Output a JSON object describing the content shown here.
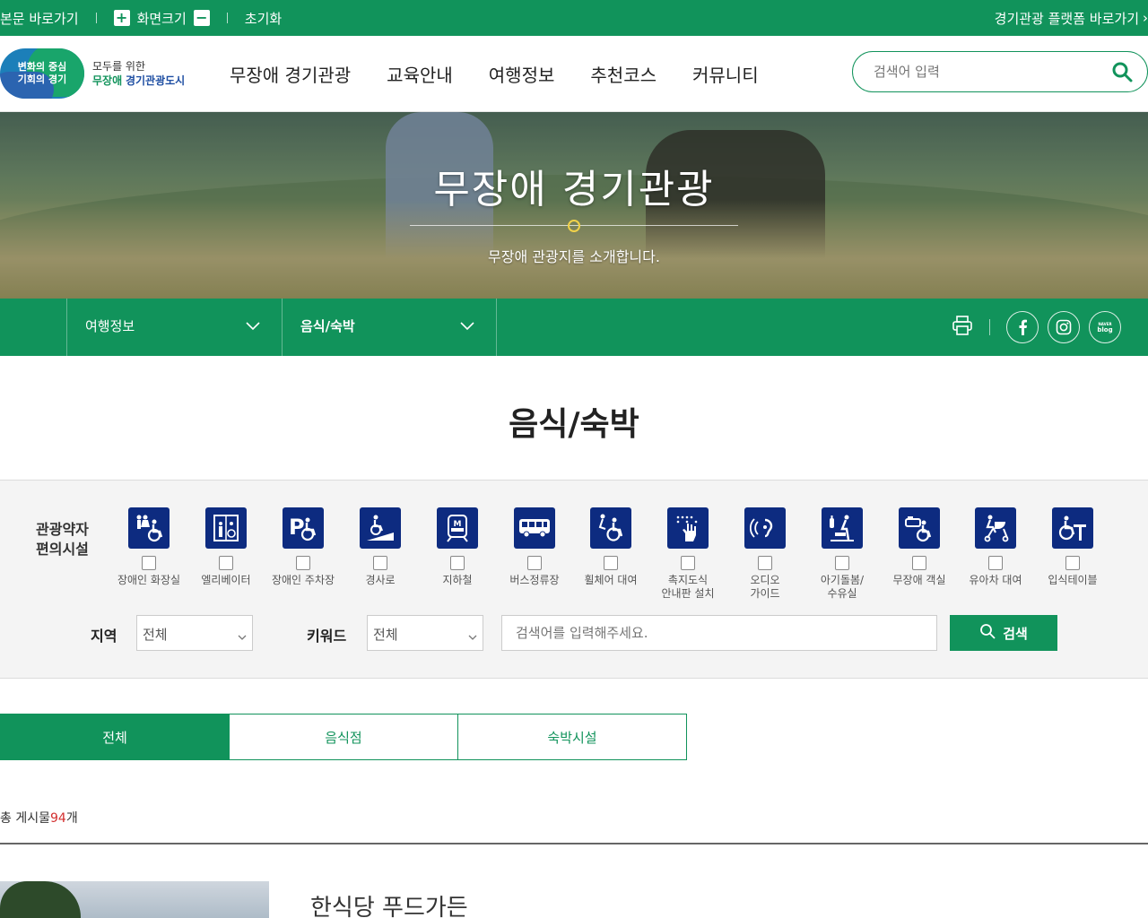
{
  "topbar": {
    "skip_link": "본문 바로가기",
    "zoom_label": "화면크기",
    "reset_label": "초기화",
    "platform_link": "경기관광 플랫폼 바로가기"
  },
  "header": {
    "logo_badge": "변화의 중심\n기회의 경기",
    "logo_line1": "모두를 위한",
    "logo_line2_a": "무장애",
    "logo_line2_b": "경기관광도시",
    "nav": [
      "무장애 경기관광",
      "교육안내",
      "여행정보",
      "추천코스",
      "커뮤니티"
    ],
    "search_placeholder": "검색어 입력"
  },
  "hero": {
    "title": "무장애 경기관광",
    "subtitle": "무장애 관광지를 소개합니다."
  },
  "subnav": {
    "depth1": "여행정보",
    "depth2": "음식/숙박"
  },
  "page": {
    "title": "음식/숙박"
  },
  "filter": {
    "title": "관광약자\n편의시설",
    "facilities": [
      {
        "label": "장애인 화장실",
        "icon": "accessible-restroom-icon"
      },
      {
        "label": "엘리베이터",
        "icon": "elevator-icon"
      },
      {
        "label": "장애인 주차장",
        "icon": "accessible-parking-icon"
      },
      {
        "label": "경사로",
        "icon": "ramp-icon"
      },
      {
        "label": "지하철",
        "icon": "subway-icon"
      },
      {
        "label": "버스정류장",
        "icon": "bus-stop-icon"
      },
      {
        "label": "휠체어 대여",
        "icon": "wheelchair-rental-icon"
      },
      {
        "label": "촉지도식\n안내판 설치",
        "icon": "tactile-map-icon"
      },
      {
        "label": "오디오\n가이드",
        "icon": "audio-guide-icon"
      },
      {
        "label": "아기돌봄/\n수유실",
        "icon": "nursing-room-icon"
      },
      {
        "label": "무장애 객실",
        "icon": "accessible-room-icon"
      },
      {
        "label": "유아차 대여",
        "icon": "stroller-rental-icon"
      },
      {
        "label": "입식테이블",
        "icon": "standing-table-icon"
      }
    ],
    "region_label": "지역",
    "region_value": "전체",
    "keyword_label": "키워드",
    "keyword_value": "전체",
    "search_placeholder": "검색어를 입력해주세요.",
    "search_button": "검색"
  },
  "tabs": [
    "전체",
    "음식점",
    "숙박시설"
  ],
  "active_tab": "전체",
  "total": {
    "prefix": "총 게시물",
    "count": "94",
    "suffix": "개"
  },
  "list": [
    {
      "title": "한식당 푸드가든"
    }
  ],
  "colors": {
    "brand_green": "#11935b",
    "icon_navy": "#0d2b80",
    "count_red": "#d32f2f"
  }
}
